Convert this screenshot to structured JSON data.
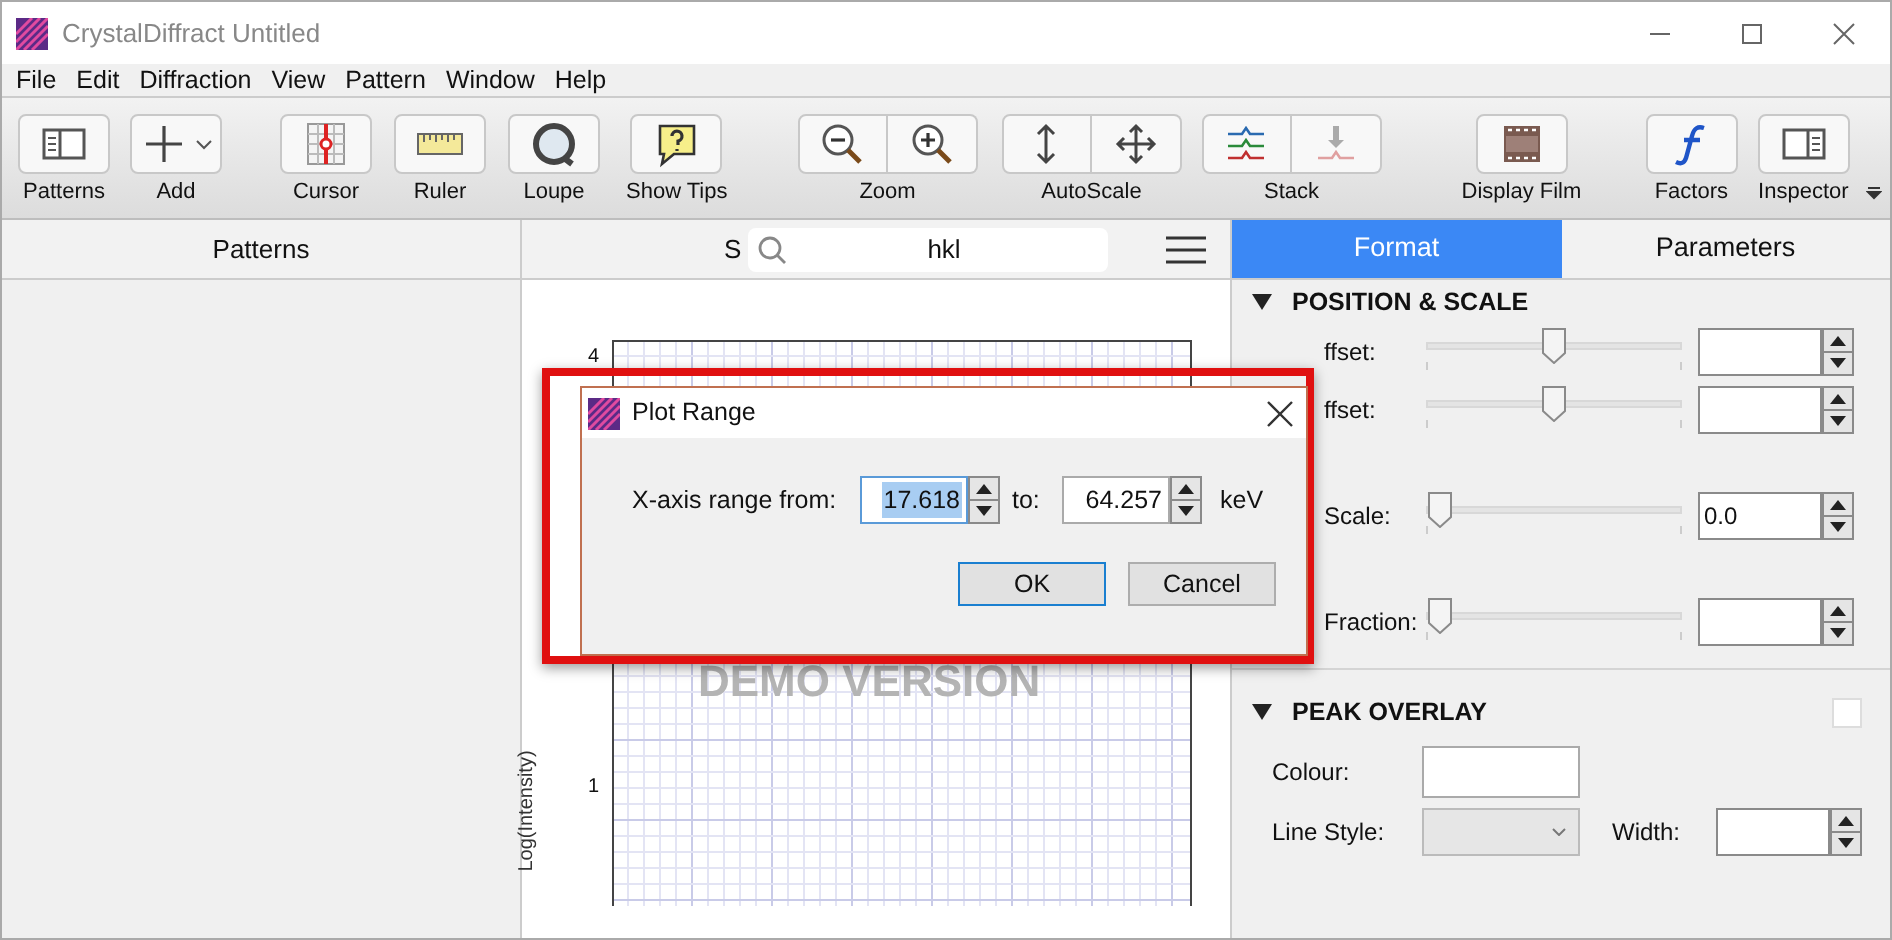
{
  "window": {
    "title": "CrystalDiffract Untitled"
  },
  "menu": [
    "File",
    "Edit",
    "Diffraction",
    "View",
    "Pattern",
    "Window",
    "Help"
  ],
  "toolbar": [
    {
      "label": "Patterns",
      "kind": "single"
    },
    {
      "label": "Add",
      "kind": "menu"
    },
    {
      "label": "Cursor",
      "kind": "single"
    },
    {
      "label": "Ruler",
      "kind": "single"
    },
    {
      "label": "Loupe",
      "kind": "single"
    },
    {
      "label": "Show Tips",
      "kind": "single"
    },
    {
      "label": "Zoom",
      "kind": "pair"
    },
    {
      "label": "AutoScale",
      "kind": "pair"
    },
    {
      "label": "Stack",
      "kind": "pair"
    },
    {
      "label": "Display Film",
      "kind": "single"
    },
    {
      "label": "Factors",
      "kind": "single"
    },
    {
      "label": "Inspector",
      "kind": "single"
    }
  ],
  "patterns_panel": {
    "title": "Patterns"
  },
  "plot_header": {
    "column_1": "S",
    "search": {
      "value": "hkl"
    }
  },
  "plot": {
    "ylabel": "Log(Intensity)",
    "yticks": [
      "4",
      "1"
    ],
    "watermark": "DEMO VERSION"
  },
  "inspector": {
    "tabs": [
      {
        "label": "Format",
        "selected": true
      },
      {
        "label": "Parameters",
        "selected": false
      }
    ],
    "sections": [
      {
        "title": "POSITION & SCALE",
        "expanded": true,
        "rows": [
          {
            "label": "ffset:",
            "level": 0.5,
            "value": ""
          },
          {
            "label": "ffset:",
            "level": 0.5,
            "value": ""
          },
          {
            "label": "Scale:",
            "level": 0,
            "value": "0.0"
          },
          {
            "label": "Fraction:",
            "level": 0,
            "value": ""
          }
        ]
      },
      {
        "title": "PEAK OVERLAY",
        "expanded": true,
        "checked": false,
        "colour_label": "Colour:",
        "line_style_label": "Line Style:",
        "width_label": "Width:"
      }
    ]
  },
  "dialog": {
    "title": "Plot Range",
    "from_label": "X-axis range from:",
    "from": "17.618",
    "from_selected": true,
    "to_label": "to:",
    "to": "64.257",
    "unit": "keV",
    "buttons": [
      {
        "label": "OK",
        "default": true
      },
      {
        "label": "Cancel",
        "default": false
      }
    ]
  }
}
